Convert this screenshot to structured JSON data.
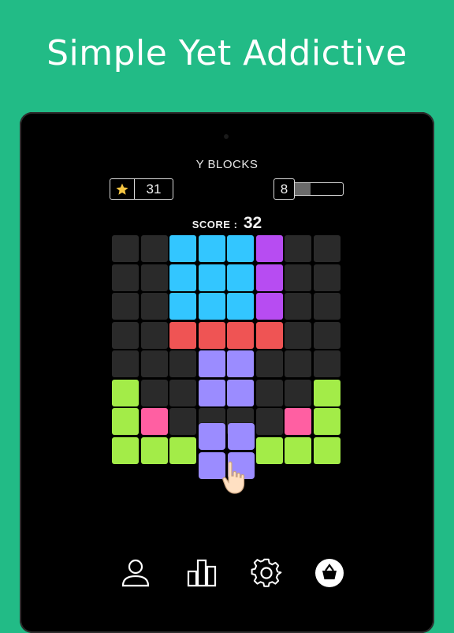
{
  "promo": {
    "headline": "Simple Yet Addictive"
  },
  "colors": {
    "background": "#22bb86",
    "empty": "#2a2a2a",
    "cyan": "#33c6ff",
    "purple": "#b74cf2",
    "red": "#ef5454",
    "lavender": "#9b8cff",
    "lime": "#a3ec48",
    "pink": "#ff5fa2"
  },
  "game": {
    "title": "Y BLOCKS",
    "stars": "31",
    "level": "8",
    "level_progress": 0.32,
    "score_label": "SCORE :",
    "score_value": "32"
  },
  "board": {
    "rows": [
      [
        "empty",
        "empty",
        "cyan",
        "cyan",
        "cyan",
        "purple",
        "empty",
        "empty"
      ],
      [
        "empty",
        "empty",
        "cyan",
        "cyan",
        "cyan",
        "purple",
        "empty",
        "empty"
      ],
      [
        "empty",
        "empty",
        "cyan",
        "cyan",
        "cyan",
        "purple",
        "empty",
        "empty"
      ],
      [
        "empty",
        "empty",
        "red",
        "red",
        "red",
        "red",
        "empty",
        "empty"
      ],
      [
        "empty",
        "empty",
        "empty",
        "lavender",
        "lavender",
        "empty",
        "empty",
        "empty"
      ],
      [
        "lime",
        "empty",
        "empty",
        "lavender",
        "lavender",
        "empty",
        "empty",
        "lime"
      ],
      [
        "lime",
        "pink",
        "empty",
        "empty",
        "empty",
        "empty",
        "pink",
        "lime"
      ],
      [
        "lime",
        "lime",
        "lime",
        "none",
        "none",
        "lime",
        "lime",
        "lime"
      ]
    ],
    "dragged_piece": {
      "color": "lavender",
      "shape": "2x2 square"
    }
  },
  "nav": {
    "items": [
      {
        "name": "profile",
        "icon": "person-icon"
      },
      {
        "name": "leaderboard",
        "icon": "bar-chart-icon"
      },
      {
        "name": "settings",
        "icon": "gear-icon"
      },
      {
        "name": "shop",
        "icon": "basket-icon"
      }
    ]
  }
}
